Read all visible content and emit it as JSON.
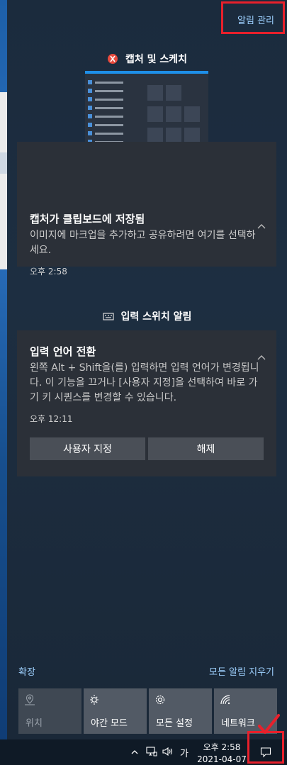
{
  "header": {
    "manage_label": "알림 관리"
  },
  "groups": [
    {
      "title": "캡처 및 스케치",
      "icon": "snip-sketch-icon",
      "notification": {
        "title": "캡처가 클립보드에 저장됨",
        "body": "이미지에 마크업을 추가하고 공유하려면 여기를 선택하세요.",
        "time": "오후 2:58"
      }
    },
    {
      "title": "입력 스위치 알림",
      "icon": "keyboard-icon",
      "notification": {
        "title": "입력 언어 전환",
        "body": "왼쪽 Alt + Shift을(를) 입력하면 입력 언어가 변경됩니다. 이 기능을 끄거나 [사용자 지정]을 선택하여 바로 가기 키 시퀀스를 변경할 수 있습니다.",
        "time": "오후 12:11",
        "actions": [
          "사용자 지정",
          "해제"
        ]
      }
    }
  ],
  "footer": {
    "expand_label": "확장",
    "clear_all_label": "모든 알림 지우기",
    "quick_actions": [
      {
        "label": "위치",
        "icon": "location-icon",
        "enabled": false
      },
      {
        "label": "야간 모드",
        "icon": "night-light-icon",
        "enabled": true
      },
      {
        "label": "모든 설정",
        "icon": "gear-icon",
        "enabled": true
      },
      {
        "label": "네트워크",
        "icon": "network-icon",
        "enabled": true
      }
    ]
  },
  "taskbar": {
    "time": "오후 2:58",
    "date": "2021-04-07",
    "ime": "가"
  },
  "colors": {
    "accent_link": "#9ed1ff",
    "highlight": "#e8202b",
    "panel_bg": "#1d2e41",
    "card_bg": "#2b3038"
  }
}
